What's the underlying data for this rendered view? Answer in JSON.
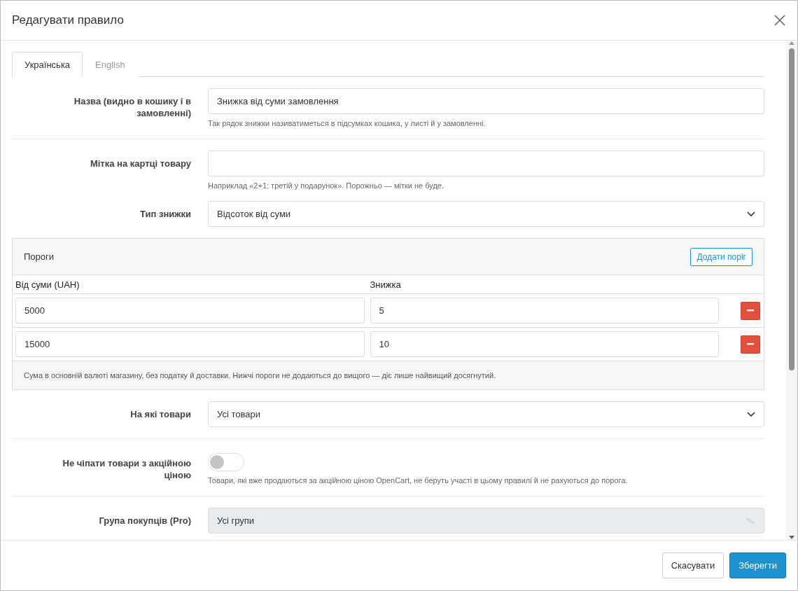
{
  "dialog": {
    "title": "Редагувати правило"
  },
  "tabs": [
    {
      "label": "Українська",
      "selected": true
    },
    {
      "label": "English",
      "selected": false
    }
  ],
  "fields": [
    {
      "kind": "text",
      "label": "Назва (видно в кошику і в замовленні)",
      "value": "Знижка від суми замовлення",
      "help": "Так рядок знижки називатиметься в підсумках кошика, у листі й у замовленні.",
      "separated": true
    },
    {
      "kind": "text",
      "label": "Мітка на картці товару",
      "help": "Наприклад «2+1: третій у подарунок». Порожньо — мітки не буде.",
      "separated": false
    },
    {
      "kind": "select",
      "label": "Тип знижки",
      "value": "Відсоток від суми",
      "disabled": false,
      "separated": false
    },
    {
      "kind": "thresholds",
      "title": "Пороги",
      "add_button": "Додати поріг",
      "columns": [
        "Від суми (UAH)",
        "Знижка"
      ],
      "rows": [
        {
          "amount": "5000",
          "discount": "5"
        },
        {
          "amount": "15000",
          "discount": "10"
        }
      ],
      "note": "Сума в основній валюті магазину, без податку й доставки. Нижчі пороги не додаються до вищого — діє лише найвищий досягнутий."
    },
    {
      "kind": "select",
      "label": "На які товари",
      "value": "Усі товари",
      "disabled": false,
      "separated": true
    },
    {
      "kind": "toggle",
      "label": "Не чіпати товари з акційною ціною",
      "on": false,
      "help": "Товари, які вже продаються за акційною ціною OpenCart, не беруть участі в цьому правилі й не рахуються до порога.",
      "separated": true
    },
    {
      "kind": "select",
      "label": "Група покупців (Pro)",
      "value": "Усі групи",
      "disabled": true,
      "separated": false
    }
  ],
  "footer": {
    "cancel": "Скасувати",
    "save": "Зберегти"
  }
}
